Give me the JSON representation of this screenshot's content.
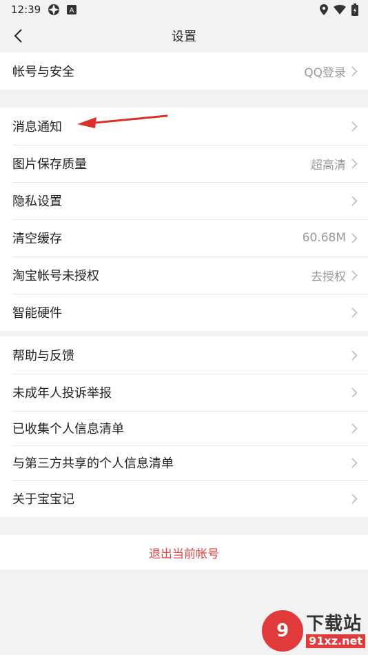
{
  "status": {
    "time": "12:39",
    "icons": [
      "network-icon",
      "a-notification-icon",
      "location-icon",
      "wifi-icon",
      "battery-icon"
    ]
  },
  "header": {
    "title": "设置",
    "back_icon": "chevron-left-icon"
  },
  "groups": [
    {
      "items": [
        {
          "label": "帐号与安全",
          "value": "QQ登录"
        }
      ]
    },
    {
      "items": [
        {
          "label": "消息通知",
          "value": ""
        },
        {
          "label": "图片保存质量",
          "value": "超高清"
        },
        {
          "label": "隐私设置",
          "value": ""
        },
        {
          "label": "清空缓存",
          "value": "60.68M"
        },
        {
          "label": "淘宝帐号未授权",
          "value": "去授权"
        },
        {
          "label": "智能硬件",
          "value": ""
        }
      ]
    },
    {
      "items": [
        {
          "label": "帮助与反馈",
          "value": ""
        },
        {
          "label": "未成年人投诉举报",
          "value": ""
        },
        {
          "label": "已收集个人信息清单",
          "value": ""
        },
        {
          "label": "与第三方共享的个人信息清单",
          "value": ""
        },
        {
          "label": "关于宝宝记",
          "value": ""
        }
      ]
    }
  ],
  "logout_label": "退出当前帐号",
  "watermark": {
    "logo": "9",
    "cn": "下载站",
    "en": "91xz.net"
  },
  "colors": {
    "background": "#f2f2f2",
    "logout": "#e64545",
    "arrow": "#d9302c",
    "value_text": "#999999"
  }
}
